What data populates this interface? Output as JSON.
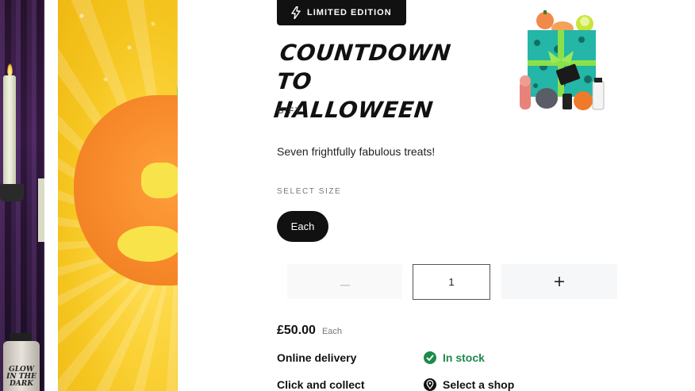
{
  "product": {
    "badge": "LIMITED EDITION",
    "badge_icon": "lightning-icon",
    "title": "COUNTDOWN TO HALLOWEEN",
    "category": "GIFT",
    "description": "Seven frightfully fabulous treats!",
    "size_label": "SELECT SIZE",
    "selected_size": "Each"
  },
  "quantity": {
    "value": "1",
    "minus_icon": "minus-icon",
    "plus_icon": "plus-icon"
  },
  "price": {
    "value": "£50.00",
    "unit": "Each"
  },
  "fulfilment": {
    "delivery_label": "Online delivery",
    "delivery_status": "In stock",
    "collect_label": "Click and collect",
    "collect_action": "Select a shop"
  },
  "imagery": {
    "bottle_label": "GLOW IN THE DARK"
  },
  "colors": {
    "in_stock": "#1e8a4a",
    "primary": "#111111",
    "badge_bg": "#111111"
  }
}
